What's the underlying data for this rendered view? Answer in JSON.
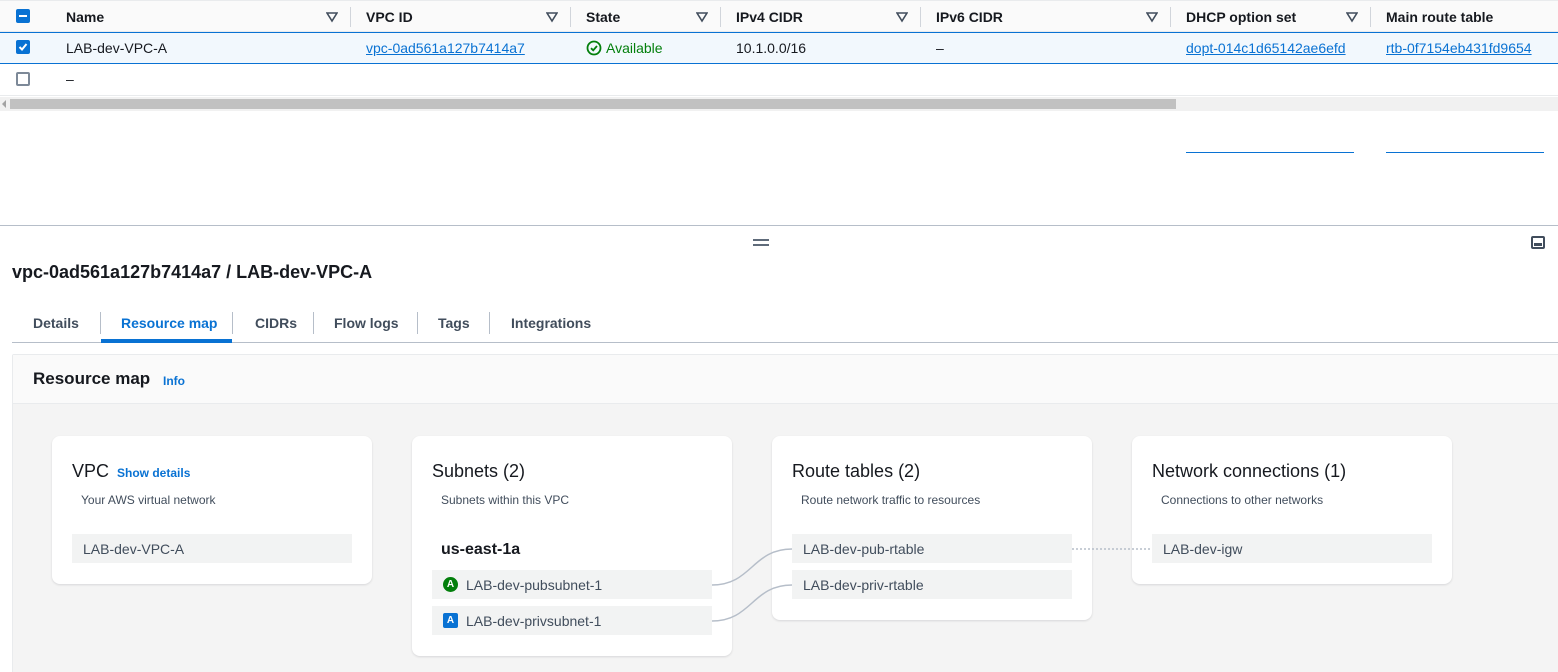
{
  "table": {
    "headers": {
      "name": "Name",
      "vpc_id": "VPC ID",
      "state": "State",
      "ipv4": "IPv4 CIDR",
      "ipv6": "IPv6 CIDR",
      "dhcp": "DHCP option set",
      "route": "Main route table"
    },
    "rows": [
      {
        "name": "LAB-dev-VPC-A",
        "vpc_id": "vpc-0ad561a127b7414a7",
        "state": "Available",
        "ipv4": "10.1.0.0/16",
        "ipv6": "–",
        "dhcp": "dopt-014c1d65142ae6efd",
        "route": "rtb-0f7154eb431fd9654"
      },
      {
        "name": "–"
      }
    ]
  },
  "detail": {
    "title": "vpc-0ad561a127b7414a7 / LAB-dev-VPC-A",
    "tabs": [
      "Details",
      "Resource map",
      "CIDRs",
      "Flow logs",
      "Tags",
      "Integrations"
    ]
  },
  "resource_map": {
    "title": "Resource map",
    "info": "Info",
    "vpc": {
      "title": "VPC",
      "show_details": "Show details",
      "subtitle": "Your AWS virtual network",
      "item": "LAB-dev-VPC-A"
    },
    "subnets": {
      "title": "Subnets (2)",
      "subtitle": "Subnets within this VPC",
      "az": "us-east-1a",
      "items": [
        {
          "badge": "A",
          "label": "LAB-dev-pubsubnet-1"
        },
        {
          "badge": "A",
          "label": "LAB-dev-privsubnet-1"
        }
      ]
    },
    "route_tables": {
      "title": "Route tables (2)",
      "subtitle": "Route network traffic to resources",
      "items": [
        "LAB-dev-pub-rtable",
        "LAB-dev-priv-rtable"
      ]
    },
    "network_connections": {
      "title": "Network connections (1)",
      "subtitle": "Connections to other networks",
      "items": [
        "LAB-dev-igw"
      ]
    }
  },
  "colors": {
    "link": "#0972d3",
    "available": "#037f0c",
    "selected_row_bg": "#f2f8fd"
  }
}
